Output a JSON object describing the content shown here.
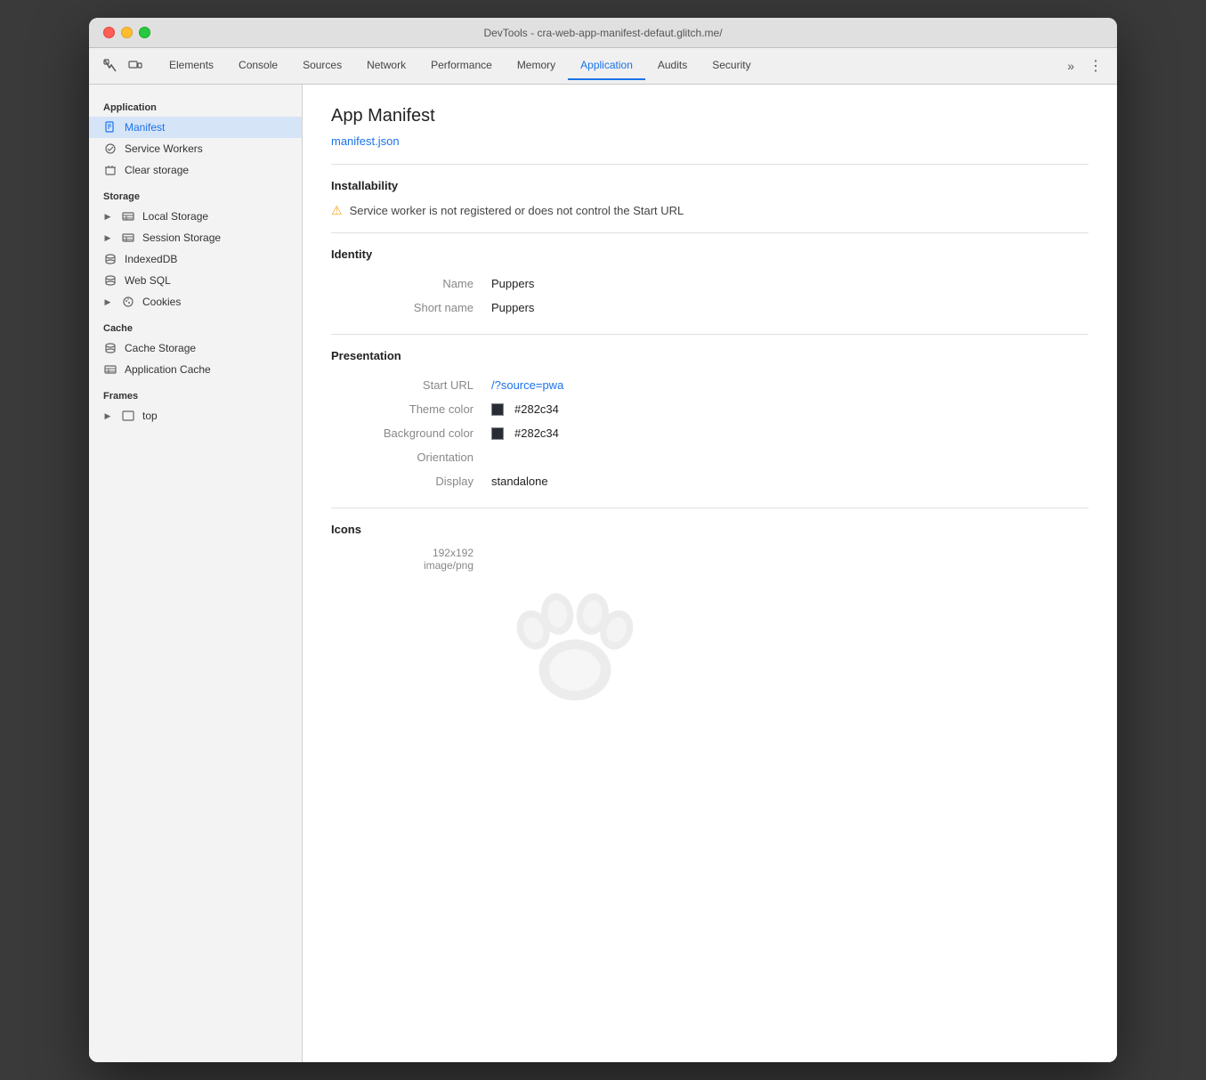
{
  "window": {
    "title": "DevTools - cra-web-app-manifest-defaut.glitch.me/"
  },
  "tabs": {
    "items": [
      {
        "label": "Elements",
        "active": false
      },
      {
        "label": "Console",
        "active": false
      },
      {
        "label": "Sources",
        "active": false
      },
      {
        "label": "Network",
        "active": false
      },
      {
        "label": "Performance",
        "active": false
      },
      {
        "label": "Memory",
        "active": false
      },
      {
        "label": "Application",
        "active": true
      },
      {
        "label": "Audits",
        "active": false
      },
      {
        "label": "Security",
        "active": false
      }
    ],
    "overflow_label": "»"
  },
  "sidebar": {
    "application_label": "Application",
    "manifest_label": "Manifest",
    "service_workers_label": "Service Workers",
    "clear_storage_label": "Clear storage",
    "storage_label": "Storage",
    "local_storage_label": "Local Storage",
    "session_storage_label": "Session Storage",
    "indexeddb_label": "IndexedDB",
    "websql_label": "Web SQL",
    "cookies_label": "Cookies",
    "cache_label": "Cache",
    "cache_storage_label": "Cache Storage",
    "application_cache_label": "Application Cache",
    "frames_label": "Frames",
    "top_label": "top"
  },
  "content": {
    "page_title": "App Manifest",
    "manifest_link": "manifest.json",
    "installability_heading": "Installability",
    "warning_text": "Service worker is not registered or does not control the Start URL",
    "identity_heading": "Identity",
    "name_label": "Name",
    "name_value": "Puppers",
    "short_name_label": "Short name",
    "short_name_value": "Puppers",
    "presentation_heading": "Presentation",
    "start_url_label": "Start URL",
    "start_url_value": "/?source=pwa",
    "theme_color_label": "Theme color",
    "theme_color_value": "#282c34",
    "theme_color_hex": "#282c34",
    "bg_color_label": "Background color",
    "bg_color_value": "#282c34",
    "bg_color_hex": "#282c34",
    "orientation_label": "Orientation",
    "orientation_value": "",
    "display_label": "Display",
    "display_value": "standalone",
    "icons_heading": "Icons",
    "icon_size": "192x192",
    "icon_type": "image/png"
  }
}
